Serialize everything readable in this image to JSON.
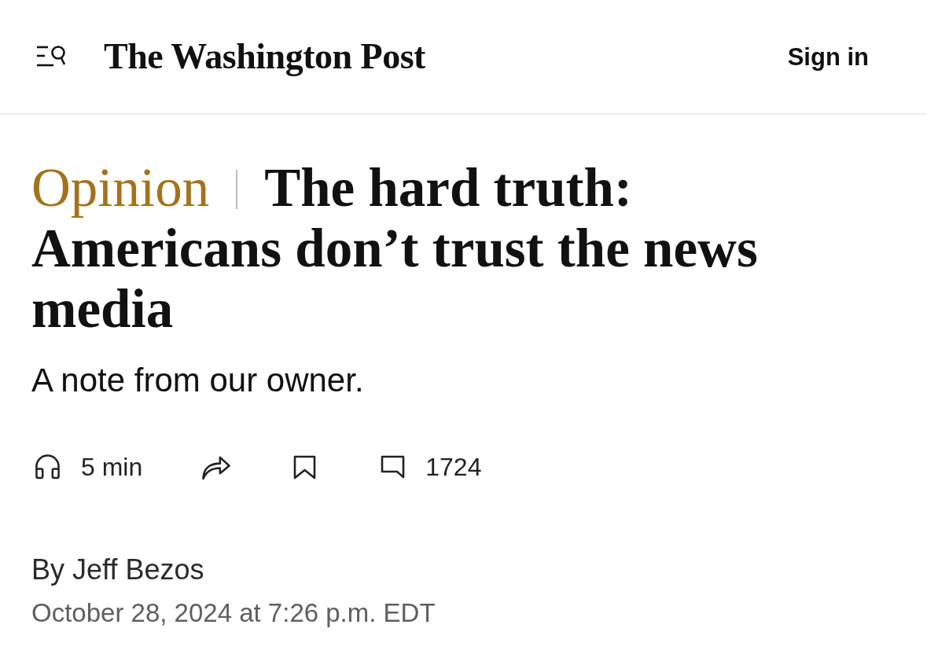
{
  "header": {
    "logo": "The Washington Post",
    "sign_in": "Sign in"
  },
  "article": {
    "section": "Opinion",
    "headline": "The hard truth: Americans don’t trust the news media",
    "subheadline": "A note from our owner.",
    "actions": [
      {
        "kind": "listen",
        "label": "5 min"
      },
      {
        "kind": "share"
      },
      {
        "kind": "save"
      },
      {
        "kind": "comments",
        "label": "1724"
      }
    ],
    "byline": "By Jeff Bezos",
    "timestamp": "October 28, 2024 at 7:26 p.m. EDT"
  }
}
